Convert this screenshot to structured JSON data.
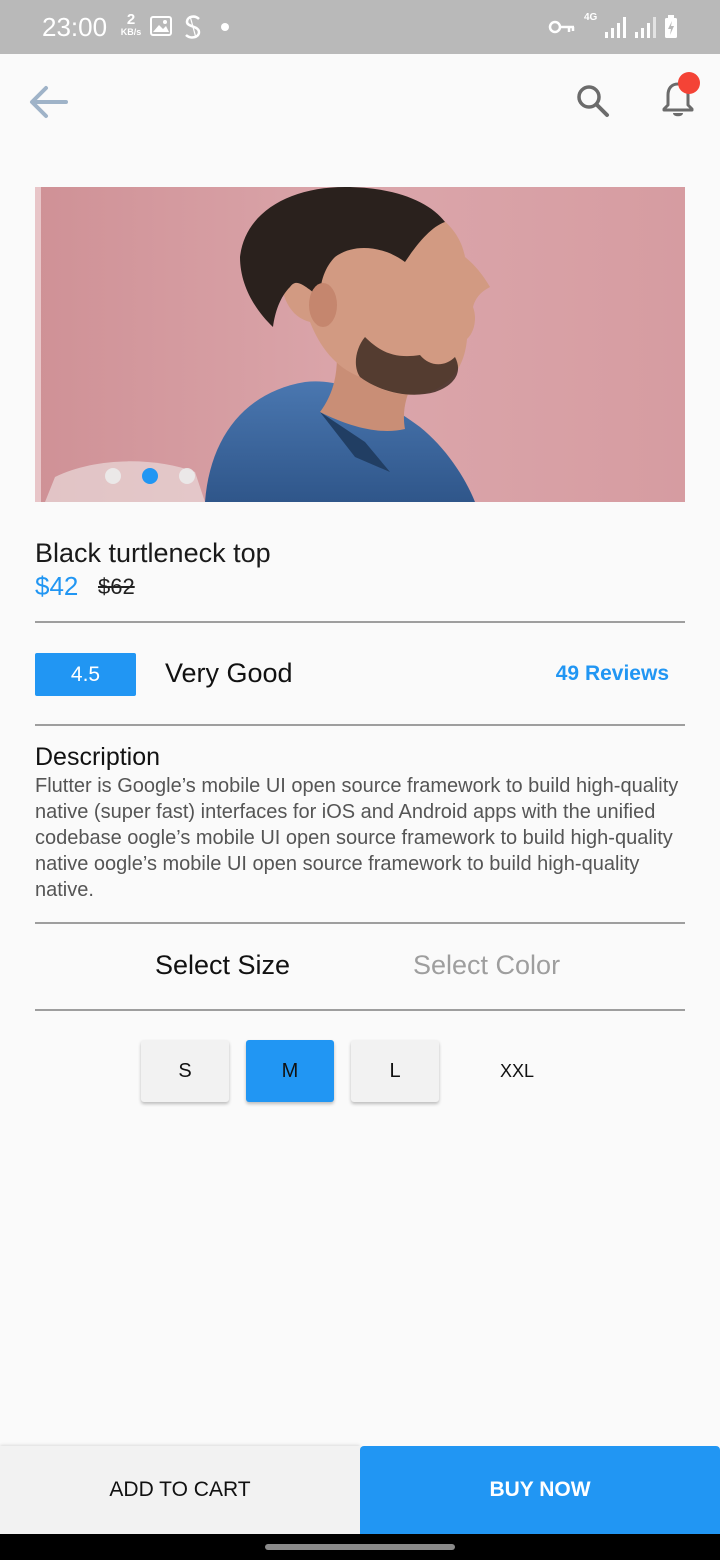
{
  "status_bar": {
    "time": "23:00",
    "net_speed_value": "2",
    "net_speed_unit": "KB/s",
    "network_type": "4G"
  },
  "app_bar": {
    "icons": [
      "arrow-back-icon",
      "search-icon",
      "bell-icon"
    ],
    "notification_badge_color": "#f44336"
  },
  "carousel": {
    "page_count": 3,
    "active_index": 1
  },
  "product": {
    "title": "Black turtleneck top",
    "price": "$42",
    "old_price": "$62"
  },
  "rating": {
    "score": "4.5",
    "label": "Very Good",
    "reviews": "49 Reviews"
  },
  "description": {
    "heading": "Description",
    "body": "Flutter is Google’s mobile UI open source framework to build high-quality native (super fast) interfaces for iOS and Android apps with the unified codebase oogle’s mobile UI open source framework to build high-quality native oogle’s mobile UI open source framework to build high-quality native."
  },
  "tabs": {
    "size": "Select Size",
    "color": "Select Color",
    "active": "size"
  },
  "sizes": {
    "options": [
      "S",
      "M",
      "L",
      "XXL"
    ],
    "selected": "M"
  },
  "actions": {
    "add_to_cart": "ADD TO CART",
    "buy_now": "BUY NOW"
  },
  "colors": {
    "accent": "#2196f3",
    "badge": "#f44336",
    "background": "#fafafa"
  }
}
